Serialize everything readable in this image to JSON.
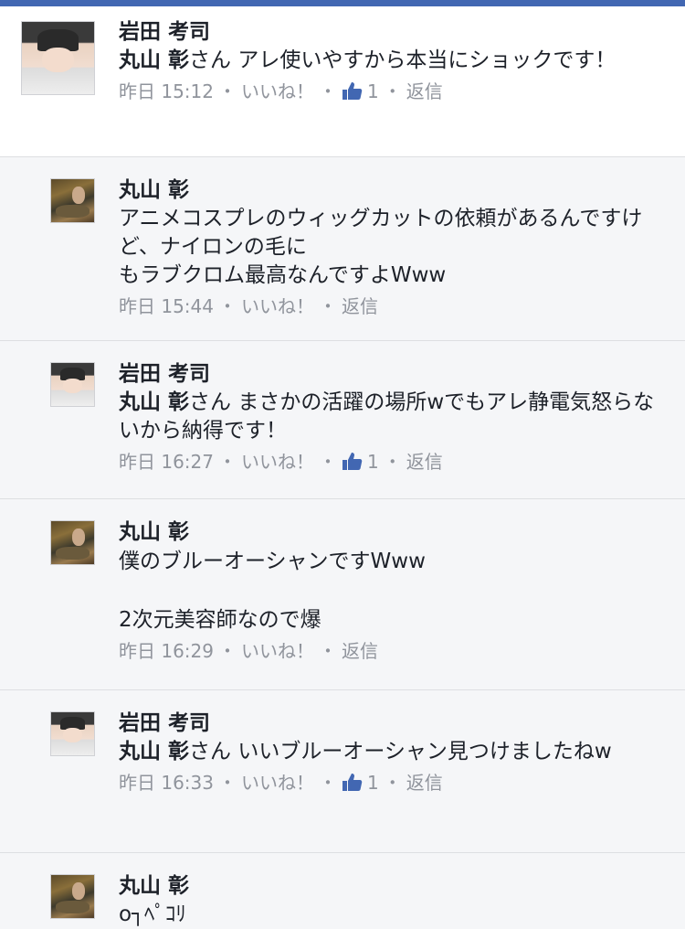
{
  "comments": [
    {
      "author": "岩田 考司",
      "mention": "丸山 彰",
      "text": "さん アレ使いやすから本当にショックです！",
      "time": "昨日 15:12",
      "like": "いいね！",
      "like_count": "1",
      "reply": "返信"
    },
    {
      "author": "丸山 彰",
      "text": "アニメコスプレのウィッグカットの依頼があるんですけど、ナイロンの毛に\nもラブクロム最高なんですよWww",
      "time": "昨日 15:44",
      "like": "いいね！",
      "reply": "返信"
    },
    {
      "author": "岩田 考司",
      "mention": "丸山 彰",
      "text": "さん まさかの活躍の場所wでもアレ静電気怒らないから納得です！",
      "time": "昨日 16:27",
      "like": "いいね！",
      "like_count": "1",
      "reply": "返信"
    },
    {
      "author": "丸山 彰",
      "text": "僕のブルーオーシャンですWww\n\n2次元美容師なので爆",
      "time": "昨日 16:29",
      "like": "いいね！",
      "reply": "返信"
    },
    {
      "author": "岩田 考司",
      "mention": "丸山 彰",
      "text": "さん いいブルーオーシャン見つけましたねw",
      "time": "昨日 16:33",
      "like": "いいね！",
      "like_count": "1",
      "reply": "返信"
    },
    {
      "author": "丸山 彰",
      "text": "o┐ﾍﾟｺﾘ"
    }
  ],
  "separator": "・",
  "colors": {
    "topbar": "#4267b2",
    "like_icon": "#4267b2",
    "meta": "#90949c"
  }
}
